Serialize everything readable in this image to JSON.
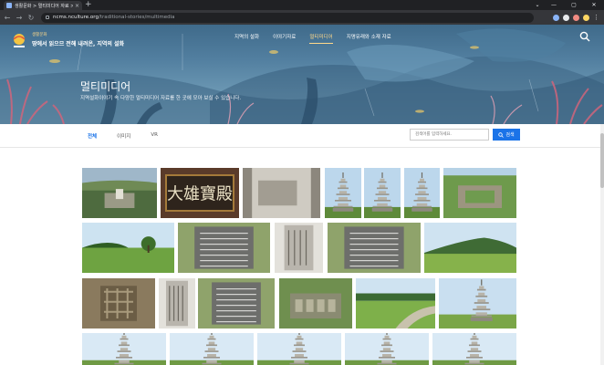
{
  "browser": {
    "tab_title": "생활문화 > 멀티미디어 자료 > 지...",
    "url_host": "ncms.nculture.org",
    "url_path": "/traditional-stories/multimedia",
    "new_tab": "+",
    "tab_close": "×"
  },
  "site": {
    "logo_small": "생활문화",
    "logo_main": "땅에서 읽으므 전해 내려온, 지역의 설화",
    "nav": [
      "지역의 설화",
      "이야기자료",
      "멀티미디어",
      "지명유래와 소재 자료"
    ],
    "active_nav_index": 2
  },
  "hero": {
    "title": "멀티미디어",
    "description": "지역설화이야기 속 다양한 멀티미디어 자료를 한 곳에 모아 보실 수 있습니다."
  },
  "filters": {
    "tabs": [
      "전체",
      "이미지",
      "VR"
    ],
    "active_index": 0,
    "search_placeholder": "검색어를 입력하세요.",
    "search_button": "검색"
  },
  "colors": {
    "accent": "#1a73e8",
    "nav_active": "#ffd98a",
    "hero_bg": "#527fa0"
  },
  "gallery": {
    "photos": [
      {
        "name": "aerial-temple-site",
        "kind": "aerial"
      },
      {
        "name": "signboard-daeung",
        "kind": "signboard",
        "text": "大雄寶殿"
      },
      {
        "name": "stone-pedestal",
        "kind": "stone"
      },
      {
        "name": "stone-pagoda-1",
        "kind": "pagoda"
      },
      {
        "name": "stone-pagoda-2",
        "kind": "pagoda"
      },
      {
        "name": "stone-pagoda-3",
        "kind": "pagoda"
      },
      {
        "name": "temple-foundation",
        "kind": "foundation"
      },
      {
        "name": "grass-field-tree",
        "kind": "field"
      },
      {
        "name": "info-board-1",
        "kind": "board"
      },
      {
        "name": "stele-inscription",
        "kind": "stele"
      },
      {
        "name": "info-board-2",
        "kind": "board"
      },
      {
        "name": "mountain-field",
        "kind": "mountain"
      },
      {
        "name": "stone-lattice",
        "kind": "lattice"
      },
      {
        "name": "stone-stele-2",
        "kind": "stele"
      },
      {
        "name": "info-board-3",
        "kind": "board"
      },
      {
        "name": "aerial-site-2",
        "kind": "aerial2"
      },
      {
        "name": "grass-path",
        "kind": "path"
      },
      {
        "name": "pagoda-field",
        "kind": "pagodafield"
      },
      {
        "name": "pagoda-row-1",
        "kind": "pagodasky"
      },
      {
        "name": "pagoda-row-2",
        "kind": "pagodasky"
      },
      {
        "name": "pagoda-row-3",
        "kind": "pagodasky"
      },
      {
        "name": "pagoda-row-4",
        "kind": "pagodasky"
      },
      {
        "name": "pagoda-row-5",
        "kind": "pagodasky"
      }
    ]
  }
}
